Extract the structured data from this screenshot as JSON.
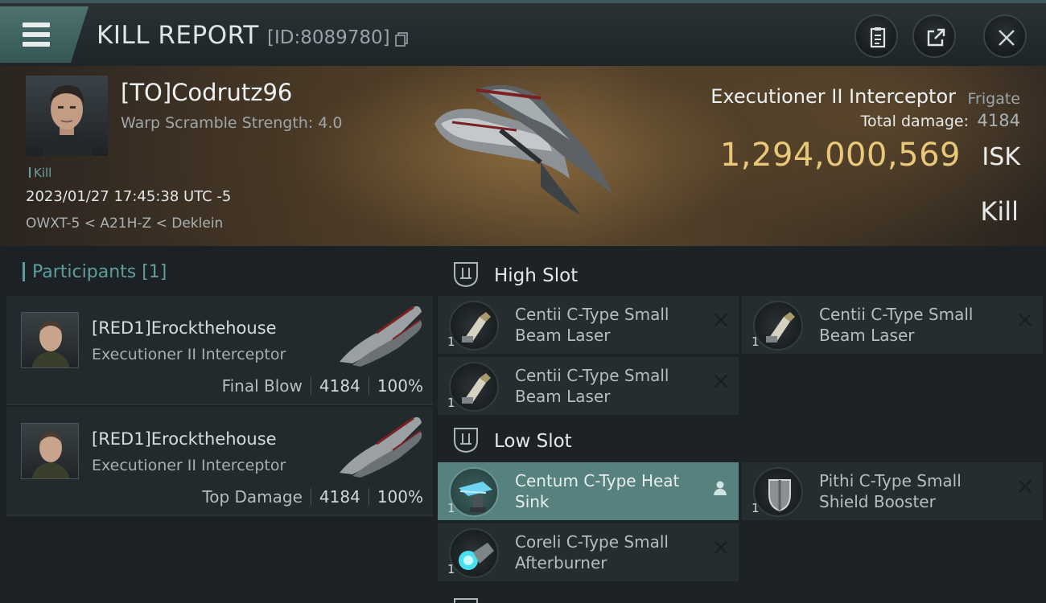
{
  "header": {
    "title": "KILL REPORT",
    "report_id": "[ID:8089780]",
    "menu_icon": "hamburger-icon",
    "actions": [
      "clipboard-icon",
      "share-icon",
      "close-icon"
    ]
  },
  "victim": {
    "name": "[TO]Codrutz96",
    "warp_scramble": "Warp Scramble Strength: 4.0",
    "tag": "Kill",
    "timestamp": "2023/01/27 17:45:38 UTC -5",
    "location": "OWXT-5 < A21H-Z < Deklein",
    "ship_name": "Executioner II Interceptor",
    "ship_class": "Frigate",
    "total_damage_label": "Total damage:",
    "total_damage": "4184",
    "isk_value": "1,294,000,569",
    "isk_label": "ISK",
    "kill_type": "Kill"
  },
  "participants": {
    "title": "Participants [1]",
    "items": [
      {
        "name": "[RED1]Erockthehouse",
        "ship": "Executioner II Interceptor",
        "role": "Final Blow",
        "damage": "4184",
        "percent": "100%"
      },
      {
        "name": "[RED1]Erockthehouse",
        "ship": "Executioner II Interceptor",
        "role": "Top Damage",
        "damage": "4184",
        "percent": "100%"
      }
    ]
  },
  "fitting": {
    "high_slot": {
      "label": "High Slot",
      "modules": [
        {
          "name": "Centii C-Type Small Beam Laser",
          "qty": "1",
          "icon": "beam-laser-icon"
        },
        {
          "name": "Centii C-Type Small Beam Laser",
          "qty": "1",
          "icon": "beam-laser-icon"
        },
        {
          "name": "Centii C-Type Small Beam Laser",
          "qty": "1",
          "icon": "beam-laser-icon"
        }
      ]
    },
    "low_slot": {
      "label": "Low Slot",
      "modules": [
        {
          "name": "Centum C-Type Heat Sink",
          "qty": "1",
          "icon": "heat-sink-icon",
          "selected": true
        },
        {
          "name": "Pithi C-Type Small Shield Booster",
          "qty": "1",
          "icon": "shield-booster-icon"
        },
        {
          "name": "Coreli C-Type Small Afterburner",
          "qty": "1",
          "icon": "afterburner-icon"
        }
      ]
    }
  },
  "colors": {
    "accent_teal": "#5f9e9d",
    "isk_gold": "#e9c87a",
    "selected_module": "#56817f"
  }
}
